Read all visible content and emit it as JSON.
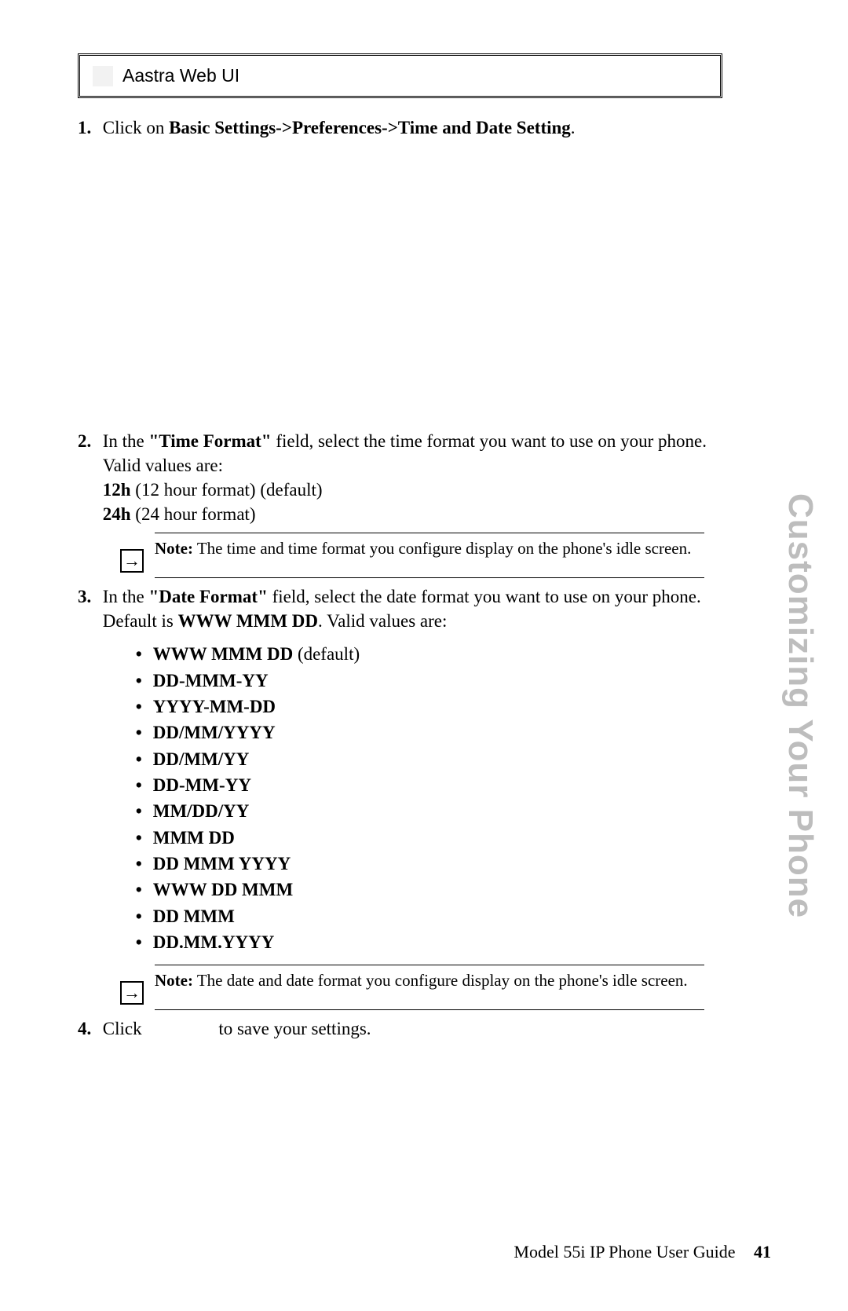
{
  "header": {
    "title": "Aastra Web UI"
  },
  "sideTab": "Customizing Your Phone",
  "steps": {
    "s1": {
      "num": "1.",
      "pre": "Click on ",
      "bold": "Basic Settings->Preferences->Time and Date Setting",
      "post": "."
    },
    "s2": {
      "num": "2.",
      "line1_pre": "In the ",
      "line1_bold": "\"Time Format\"",
      "line1_post": " field, select the time format you want to use on your phone. Valid values are:",
      "opt1_bold": "12h",
      "opt1_rest": " (12 hour format) (default)",
      "opt2_bold": "24h",
      "opt2_rest": " (24 hour format)"
    },
    "s3": {
      "num": "3.",
      "line1_pre": "In the ",
      "line1_bold": "\"Date Format\"",
      "line1_post": " field, select the date format you want to use on your phone. Default is ",
      "line1_bold2": "WWW MMM DD",
      "line1_post2": ". Valid values are:"
    },
    "s4": {
      "num": "4.",
      "pre": "Click ",
      "gap": "                ",
      "post": "to save your settings."
    }
  },
  "note1": {
    "label": "Note:",
    "text": " The time and time format you configure display on the phone's idle screen."
  },
  "note2": {
    "label": "Note:",
    "text": " The date and date format you configure display on the phone's idle screen."
  },
  "dateFormats": {
    "f0_bold": "WWW MMM DD",
    "f0_rest": " (default)",
    "f1": "DD-MMM-YY",
    "f2": "YYYY-MM-DD",
    "f3": "DD/MM/YYYY",
    "f4": "DD/MM/YY",
    "f5": "DD-MM-YY",
    "f6": "MM/DD/YY",
    "f7": "MMM DD",
    "f8": "DD MMM YYYY",
    "f9": "WWW DD MMM",
    "f10": "DD MMM",
    "f11": "DD.MM.YYYY"
  },
  "footer": {
    "text": "Model 55i IP Phone User Guide",
    "page": "41"
  },
  "icons": {
    "arrow": "→"
  }
}
